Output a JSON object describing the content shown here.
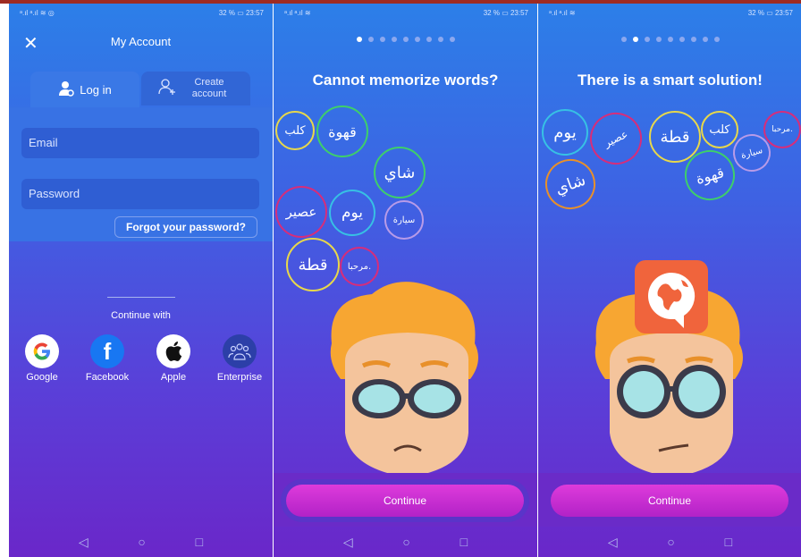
{
  "screens": [
    {
      "status": {
        "left": "ᵃ.ıl ᵃ.ıl ≋ ◎",
        "right": "32 % ▭ 23:57"
      },
      "title": "My Account",
      "tabs": {
        "login": "Log in",
        "create": "Create account"
      },
      "email_placeholder": "Email",
      "password_placeholder": "Password",
      "forgot": "Forgot your password?",
      "continue_with": "Continue with",
      "social": [
        "Google",
        "Facebook",
        "Apple",
        "Enterprise"
      ]
    },
    {
      "status": {
        "left": "ᵃ.ıl ᵃ.ıl ≋",
        "right": "32 % ▭ 23:57"
      },
      "headline": "Cannot memorize words?",
      "words": [
        "كلب",
        "قهوة",
        "شاي",
        "عصير",
        "يوم",
        "سيارة",
        "قطة",
        "مرحبا."
      ],
      "continue": "Continue"
    },
    {
      "status": {
        "left": "ᵃ.ıl ᵃ.ıl ≋",
        "right": "32 % ▭ 23:57"
      },
      "headline": "There is a smart solution!",
      "words": [
        "يوم",
        "عصير",
        "قطة",
        "كلب",
        "مرحبا.",
        "شاي",
        "قهوة",
        "سيارة"
      ],
      "continue": "Continue"
    }
  ],
  "nav": {
    "back": "◁",
    "home": "○",
    "recent": "□"
  },
  "colors": {
    "accent": "#d034d6",
    "bg_top": "#2c7fe8",
    "bg_bottom": "#6a27c9"
  }
}
